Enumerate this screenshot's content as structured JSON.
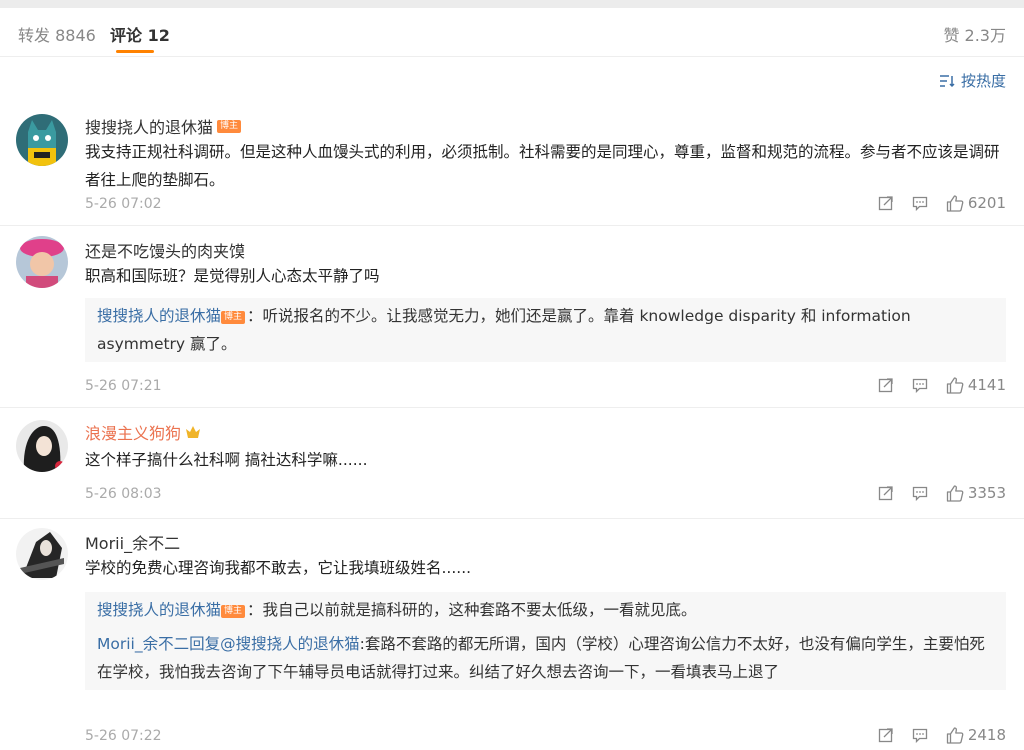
{
  "tabs": {
    "repost": "转发 8846",
    "comments": "评论 12",
    "likes": "赞 2.3万"
  },
  "sort_label": "按热度",
  "comments": [
    {
      "user": "搜搜挠人的退休猫",
      "badge": "博主",
      "text": "我支持正规社科调研。但是这种人血馒头式的利用，必须抵制。社科需要的是同理心，尊重，监督和规范的流程。参与者不应该是调研者往上爬的垫脚石。",
      "time": "5-26 07:02",
      "likes": "6201"
    },
    {
      "user": "还是不吃馒头的肉夹馍",
      "text": "职高和国际班？是觉得别人心态太平静了吗",
      "reply": {
        "name": "搜搜挠人的退休猫",
        "badge": "博主",
        "text": "：听说报名的不少。让我感觉无力，她们还是赢了。靠着 knowledge disparity 和 information asymmetry 赢了。"
      },
      "time": "5-26 07:21",
      "likes": "4141"
    },
    {
      "user": "浪漫主义狗狗",
      "text": "这个样子搞什么社科啊 搞社达科学嘛......",
      "time": "5-26 08:03",
      "likes": "3353"
    },
    {
      "user": "Morii_余不二",
      "text": "学校的免费心理咨询我都不敢去，它让我填班级姓名......",
      "reply": {
        "name": "搜搜挠人的退休猫",
        "badge": "博主",
        "text": "：我自己以前就是搞科研的，这种套路不要太低级，一看就见底。"
      },
      "reply2": {
        "name": "Morii_余不二",
        "mid": "回复",
        "at": "@搜搜挠人的退休猫",
        "text": ":套路不套路的都无所谓，国内（学校）心理咨询公信力不太好，也没有偏向学生，主要怕死在学校，我怕我去咨询了下午辅导员电话就得打过来。纠结了好久想去咨询一下，一看填表马上退了"
      },
      "time": "5-26 07:22",
      "likes": "2418"
    }
  ],
  "colors": {
    "accent": "#ff8200",
    "link": "#3a6ea5",
    "orange_name": "#eb7350"
  },
  "icons": [
    "share-icon",
    "comment-icon",
    "like-icon",
    "sort-icon",
    "crown-icon"
  ]
}
